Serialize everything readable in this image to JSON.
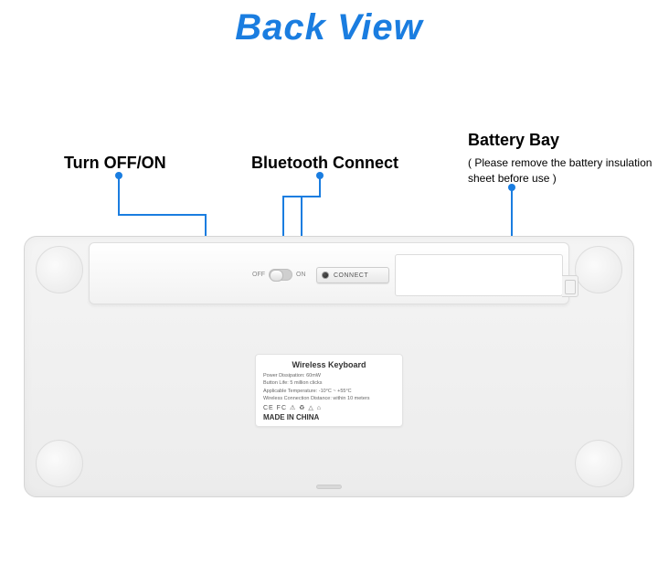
{
  "title": "Back View",
  "callouts": {
    "switch": "Turn OFF/ON",
    "bluetooth": "Bluetooth Connect",
    "battery_title": "Battery Bay",
    "battery_sub": "( Please remove the battery insulation\n  sheet before use )"
  },
  "device": {
    "switch_off": "OFF",
    "switch_on": "ON",
    "connect_label": "CONNECT",
    "spec": {
      "title": "Wireless Keyboard",
      "lines": [
        "Power Dissipation: 60mW",
        "Button Life: 5 million clicks",
        "Applicable Temperature: -10°C ~ +55°C",
        "Wireless Connection Distance: within 10 meters"
      ],
      "icons": "CE FC ⚠ ♻ △ ⌂",
      "made": "MADE IN CHINA"
    }
  },
  "colors": {
    "accent": "#1a7de0"
  }
}
